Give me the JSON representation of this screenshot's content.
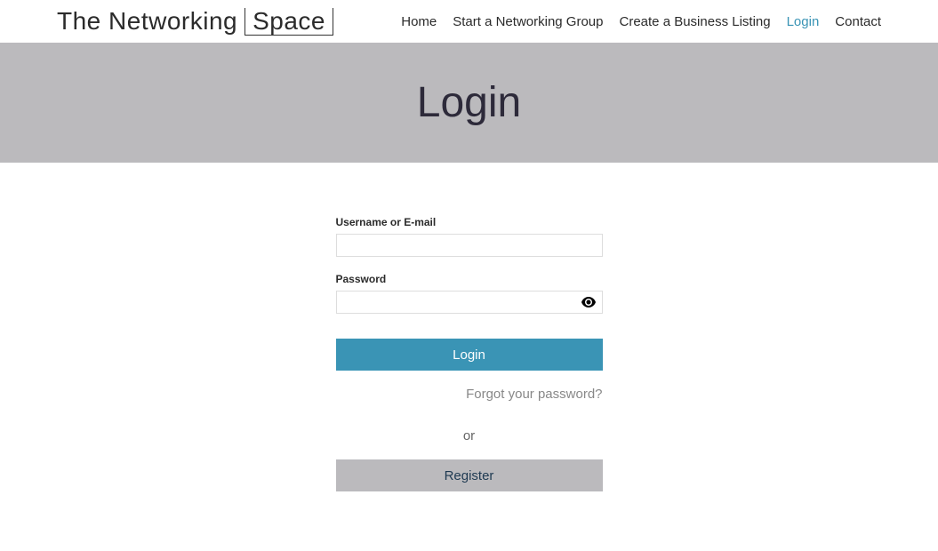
{
  "logo": {
    "prefix": "The Networking",
    "suffix": "Space"
  },
  "nav": {
    "home": "Home",
    "start_group": "Start a Networking Group",
    "create_listing": "Create a Business Listing",
    "login": "Login",
    "contact": "Contact"
  },
  "page": {
    "title": "Login"
  },
  "form": {
    "username_label": "Username or E-mail",
    "username_value": "",
    "password_label": "Password",
    "password_value": "",
    "login_button": "Login",
    "forgot_link": "Forgot your password?",
    "or_text": "or",
    "register_button": "Register"
  }
}
